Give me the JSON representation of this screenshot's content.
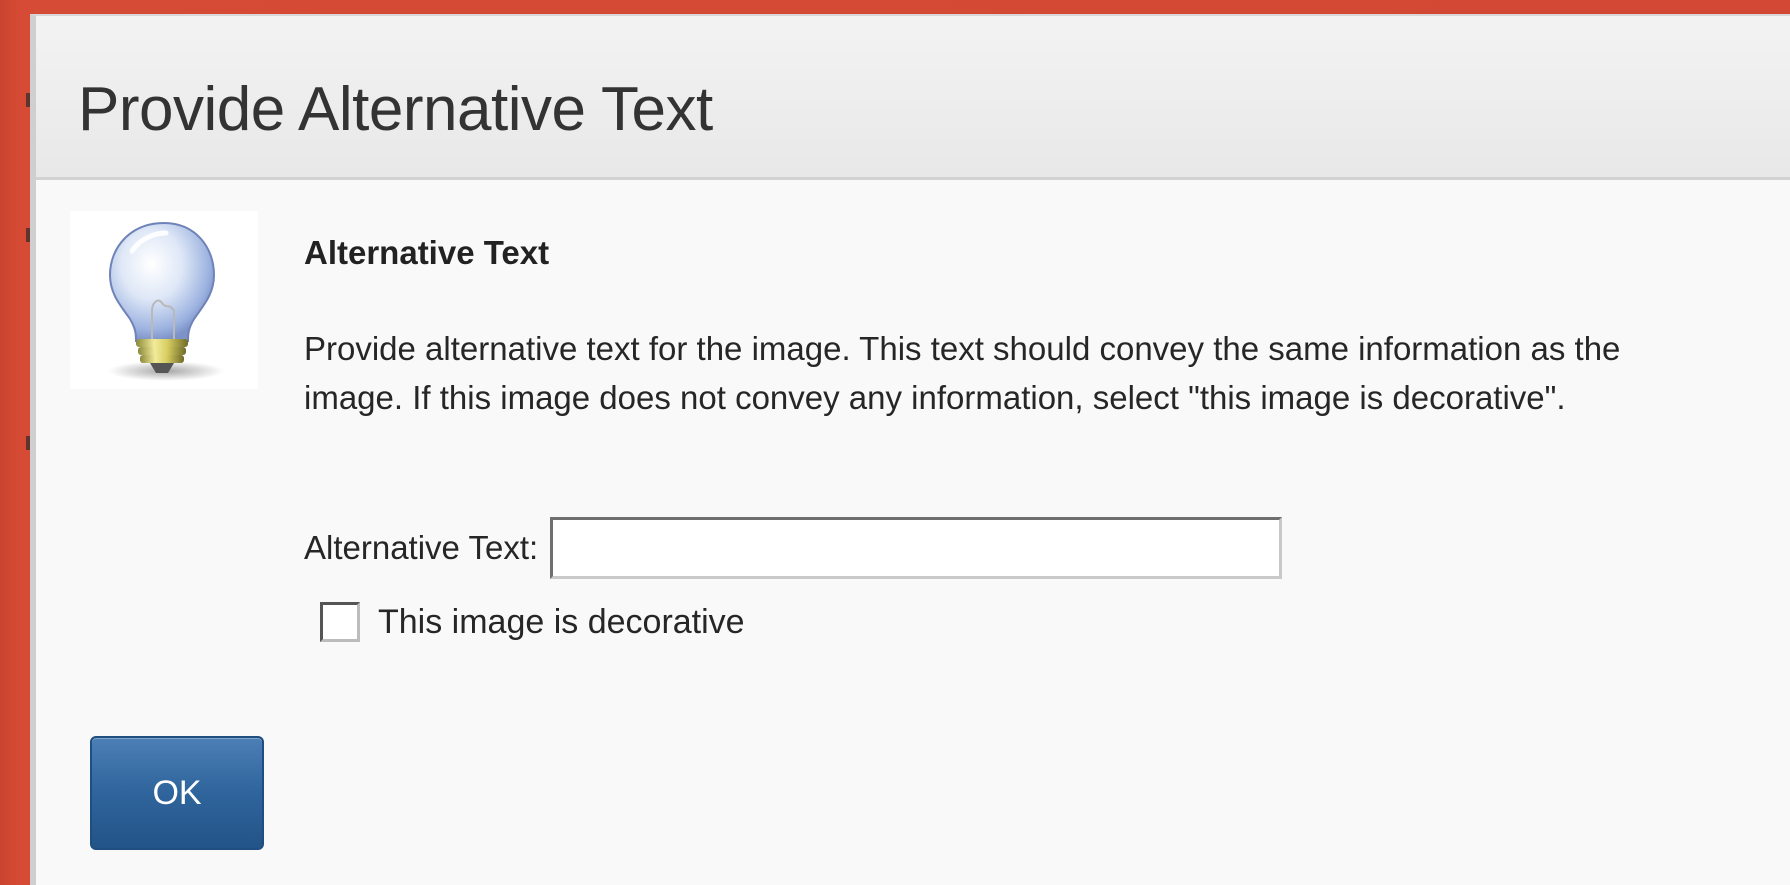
{
  "dialog": {
    "title": "Provide Alternative Text",
    "icon": "lightbulb-icon",
    "section_heading": "Alternative Text",
    "instructions": "Provide alternative text for the image. This text should convey the same information as the image. If this image does not convey any information, select \"this image is decorative\".",
    "alt_text_field": {
      "label": "Alternative Text:",
      "value": "",
      "placeholder": ""
    },
    "decorative_checkbox": {
      "label": "This image is decorative",
      "checked": false
    },
    "ok_label": "OK"
  },
  "colors": {
    "page_background": "#d24a35",
    "dialog_background": "#f9f9f9",
    "button_primary": "#2f649c"
  }
}
